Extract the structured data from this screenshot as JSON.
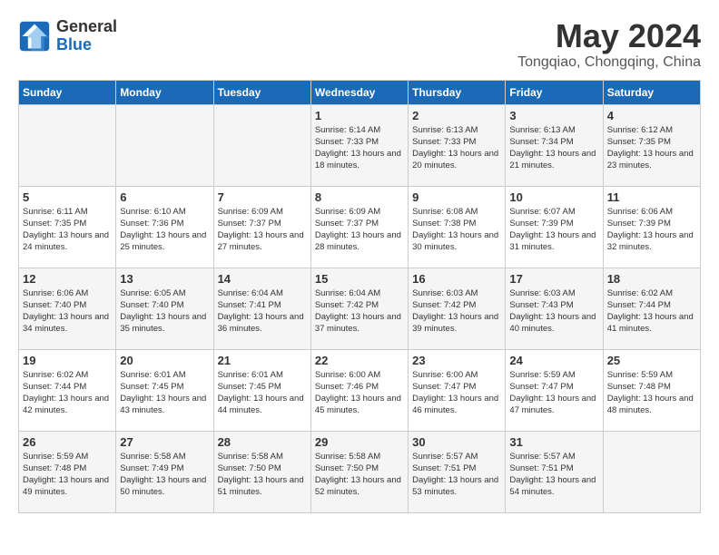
{
  "header": {
    "logo_line1": "General",
    "logo_line2": "Blue",
    "month": "May 2024",
    "location": "Tongqiao, Chongqing, China"
  },
  "weekdays": [
    "Sunday",
    "Monday",
    "Tuesday",
    "Wednesday",
    "Thursday",
    "Friday",
    "Saturday"
  ],
  "weeks": [
    [
      {
        "day": "",
        "sunrise": "",
        "sunset": "",
        "daylight": ""
      },
      {
        "day": "",
        "sunrise": "",
        "sunset": "",
        "daylight": ""
      },
      {
        "day": "",
        "sunrise": "",
        "sunset": "",
        "daylight": ""
      },
      {
        "day": "1",
        "sunrise": "Sunrise: 6:14 AM",
        "sunset": "Sunset: 7:33 PM",
        "daylight": "Daylight: 13 hours and 18 minutes."
      },
      {
        "day": "2",
        "sunrise": "Sunrise: 6:13 AM",
        "sunset": "Sunset: 7:33 PM",
        "daylight": "Daylight: 13 hours and 20 minutes."
      },
      {
        "day": "3",
        "sunrise": "Sunrise: 6:13 AM",
        "sunset": "Sunset: 7:34 PM",
        "daylight": "Daylight: 13 hours and 21 minutes."
      },
      {
        "day": "4",
        "sunrise": "Sunrise: 6:12 AM",
        "sunset": "Sunset: 7:35 PM",
        "daylight": "Daylight: 13 hours and 23 minutes."
      }
    ],
    [
      {
        "day": "5",
        "sunrise": "Sunrise: 6:11 AM",
        "sunset": "Sunset: 7:35 PM",
        "daylight": "Daylight: 13 hours and 24 minutes."
      },
      {
        "day": "6",
        "sunrise": "Sunrise: 6:10 AM",
        "sunset": "Sunset: 7:36 PM",
        "daylight": "Daylight: 13 hours and 25 minutes."
      },
      {
        "day": "7",
        "sunrise": "Sunrise: 6:09 AM",
        "sunset": "Sunset: 7:37 PM",
        "daylight": "Daylight: 13 hours and 27 minutes."
      },
      {
        "day": "8",
        "sunrise": "Sunrise: 6:09 AM",
        "sunset": "Sunset: 7:37 PM",
        "daylight": "Daylight: 13 hours and 28 minutes."
      },
      {
        "day": "9",
        "sunrise": "Sunrise: 6:08 AM",
        "sunset": "Sunset: 7:38 PM",
        "daylight": "Daylight: 13 hours and 30 minutes."
      },
      {
        "day": "10",
        "sunrise": "Sunrise: 6:07 AM",
        "sunset": "Sunset: 7:39 PM",
        "daylight": "Daylight: 13 hours and 31 minutes."
      },
      {
        "day": "11",
        "sunrise": "Sunrise: 6:06 AM",
        "sunset": "Sunset: 7:39 PM",
        "daylight": "Daylight: 13 hours and 32 minutes."
      }
    ],
    [
      {
        "day": "12",
        "sunrise": "Sunrise: 6:06 AM",
        "sunset": "Sunset: 7:40 PM",
        "daylight": "Daylight: 13 hours and 34 minutes."
      },
      {
        "day": "13",
        "sunrise": "Sunrise: 6:05 AM",
        "sunset": "Sunset: 7:40 PM",
        "daylight": "Daylight: 13 hours and 35 minutes."
      },
      {
        "day": "14",
        "sunrise": "Sunrise: 6:04 AM",
        "sunset": "Sunset: 7:41 PM",
        "daylight": "Daylight: 13 hours and 36 minutes."
      },
      {
        "day": "15",
        "sunrise": "Sunrise: 6:04 AM",
        "sunset": "Sunset: 7:42 PM",
        "daylight": "Daylight: 13 hours and 37 minutes."
      },
      {
        "day": "16",
        "sunrise": "Sunrise: 6:03 AM",
        "sunset": "Sunset: 7:42 PM",
        "daylight": "Daylight: 13 hours and 39 minutes."
      },
      {
        "day": "17",
        "sunrise": "Sunrise: 6:03 AM",
        "sunset": "Sunset: 7:43 PM",
        "daylight": "Daylight: 13 hours and 40 minutes."
      },
      {
        "day": "18",
        "sunrise": "Sunrise: 6:02 AM",
        "sunset": "Sunset: 7:44 PM",
        "daylight": "Daylight: 13 hours and 41 minutes."
      }
    ],
    [
      {
        "day": "19",
        "sunrise": "Sunrise: 6:02 AM",
        "sunset": "Sunset: 7:44 PM",
        "daylight": "Daylight: 13 hours and 42 minutes."
      },
      {
        "day": "20",
        "sunrise": "Sunrise: 6:01 AM",
        "sunset": "Sunset: 7:45 PM",
        "daylight": "Daylight: 13 hours and 43 minutes."
      },
      {
        "day": "21",
        "sunrise": "Sunrise: 6:01 AM",
        "sunset": "Sunset: 7:45 PM",
        "daylight": "Daylight: 13 hours and 44 minutes."
      },
      {
        "day": "22",
        "sunrise": "Sunrise: 6:00 AM",
        "sunset": "Sunset: 7:46 PM",
        "daylight": "Daylight: 13 hours and 45 minutes."
      },
      {
        "day": "23",
        "sunrise": "Sunrise: 6:00 AM",
        "sunset": "Sunset: 7:47 PM",
        "daylight": "Daylight: 13 hours and 46 minutes."
      },
      {
        "day": "24",
        "sunrise": "Sunrise: 5:59 AM",
        "sunset": "Sunset: 7:47 PM",
        "daylight": "Daylight: 13 hours and 47 minutes."
      },
      {
        "day": "25",
        "sunrise": "Sunrise: 5:59 AM",
        "sunset": "Sunset: 7:48 PM",
        "daylight": "Daylight: 13 hours and 48 minutes."
      }
    ],
    [
      {
        "day": "26",
        "sunrise": "Sunrise: 5:59 AM",
        "sunset": "Sunset: 7:48 PM",
        "daylight": "Daylight: 13 hours and 49 minutes."
      },
      {
        "day": "27",
        "sunrise": "Sunrise: 5:58 AM",
        "sunset": "Sunset: 7:49 PM",
        "daylight": "Daylight: 13 hours and 50 minutes."
      },
      {
        "day": "28",
        "sunrise": "Sunrise: 5:58 AM",
        "sunset": "Sunset: 7:50 PM",
        "daylight": "Daylight: 13 hours and 51 minutes."
      },
      {
        "day": "29",
        "sunrise": "Sunrise: 5:58 AM",
        "sunset": "Sunset: 7:50 PM",
        "daylight": "Daylight: 13 hours and 52 minutes."
      },
      {
        "day": "30",
        "sunrise": "Sunrise: 5:57 AM",
        "sunset": "Sunset: 7:51 PM",
        "daylight": "Daylight: 13 hours and 53 minutes."
      },
      {
        "day": "31",
        "sunrise": "Sunrise: 5:57 AM",
        "sunset": "Sunset: 7:51 PM",
        "daylight": "Daylight: 13 hours and 54 minutes."
      },
      {
        "day": "",
        "sunrise": "",
        "sunset": "",
        "daylight": ""
      }
    ]
  ]
}
